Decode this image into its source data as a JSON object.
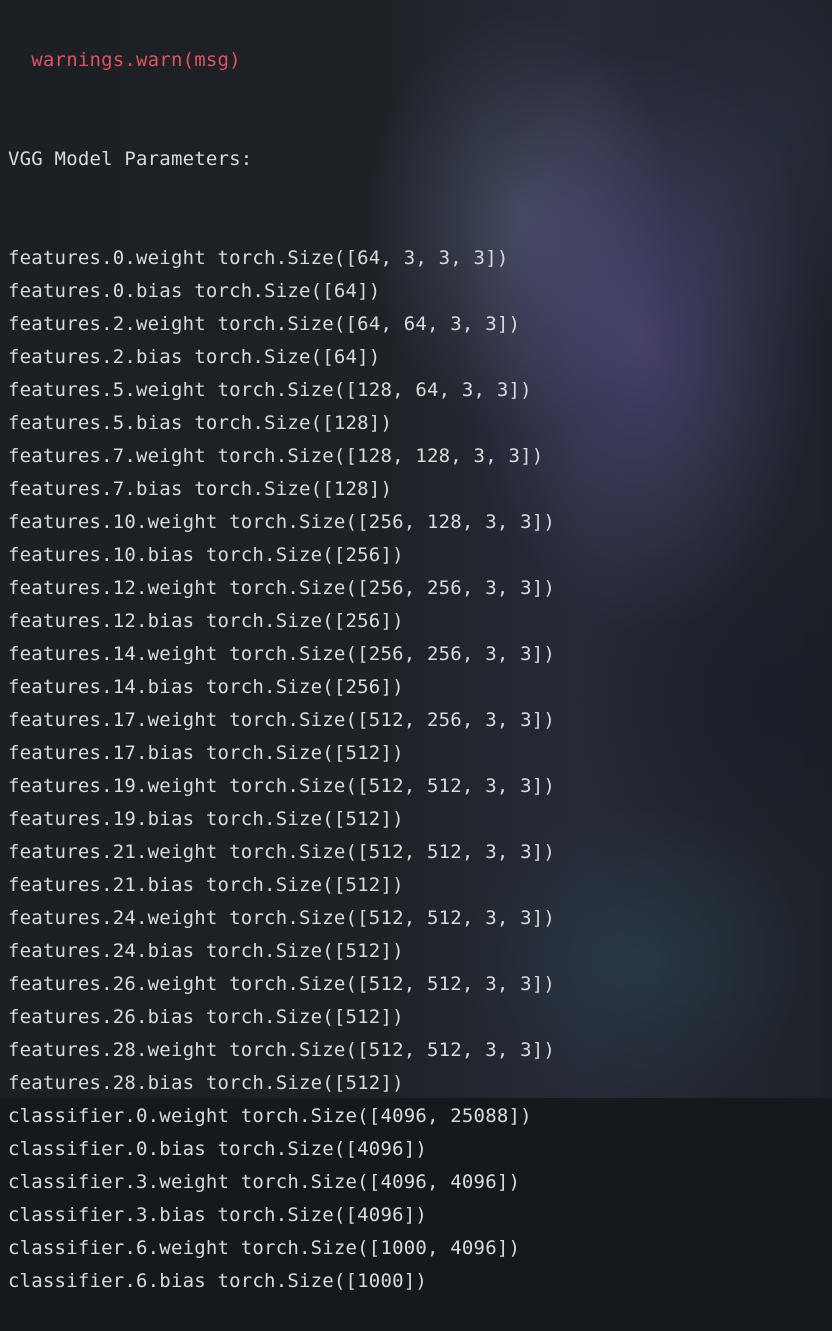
{
  "console": {
    "warning_fragment": "  warnings.warn(msg)",
    "header": "VGG Model Parameters:",
    "lines": [
      "features.0.weight torch.Size([64, 3, 3, 3])",
      "features.0.bias torch.Size([64])",
      "features.2.weight torch.Size([64, 64, 3, 3])",
      "features.2.bias torch.Size([64])",
      "features.5.weight torch.Size([128, 64, 3, 3])",
      "features.5.bias torch.Size([128])",
      "features.7.weight torch.Size([128, 128, 3, 3])",
      "features.7.bias torch.Size([128])",
      "features.10.weight torch.Size([256, 128, 3, 3])",
      "features.10.bias torch.Size([256])",
      "features.12.weight torch.Size([256, 256, 3, 3])",
      "features.12.bias torch.Size([256])",
      "features.14.weight torch.Size([256, 256, 3, 3])",
      "features.14.bias torch.Size([256])",
      "features.17.weight torch.Size([512, 256, 3, 3])",
      "features.17.bias torch.Size([512])",
      "features.19.weight torch.Size([512, 512, 3, 3])",
      "features.19.bias torch.Size([512])",
      "features.21.weight torch.Size([512, 512, 3, 3])",
      "features.21.bias torch.Size([512])",
      "features.24.weight torch.Size([512, 512, 3, 3])",
      "features.24.bias torch.Size([512])",
      "features.26.weight torch.Size([512, 512, 3, 3])",
      "features.26.bias torch.Size([512])",
      "features.28.weight torch.Size([512, 512, 3, 3])",
      "features.28.bias torch.Size([512])",
      "classifier.0.weight torch.Size([4096, 25088])",
      "classifier.0.bias torch.Size([4096])",
      "classifier.3.weight torch.Size([4096, 4096])",
      "classifier.3.bias torch.Size([4096])",
      "classifier.6.weight torch.Size([1000, 4096])",
      "classifier.6.bias torch.Size([1000])"
    ]
  },
  "colors": {
    "text": "#d8dadc",
    "warning": "#e0525f",
    "background": "#1e2227"
  }
}
